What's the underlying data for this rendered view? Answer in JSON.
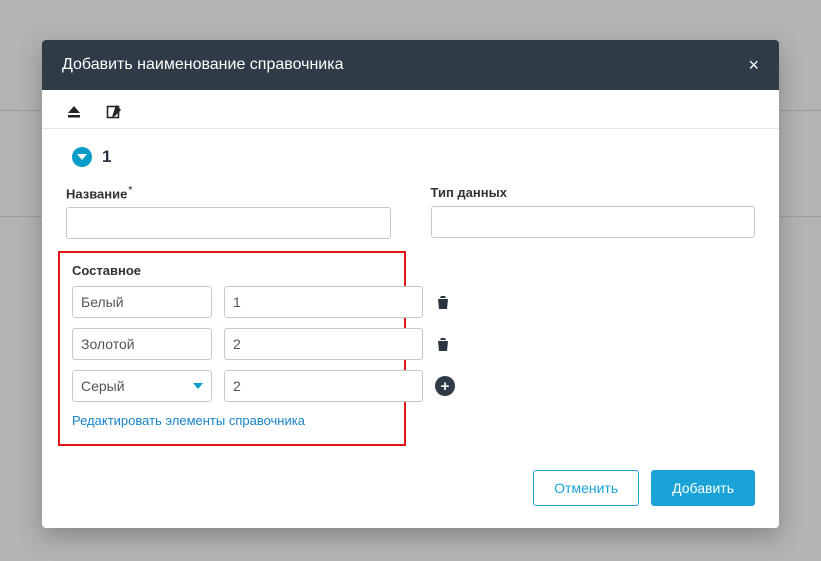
{
  "modal": {
    "title": "Добавить наименование справочника",
    "close_symbol": "×"
  },
  "section": {
    "number": "1"
  },
  "fields": {
    "name_label": "Название",
    "name_value": "",
    "type_label": "Тип данных",
    "type_value": ""
  },
  "composite": {
    "label": "Составное",
    "rows": [
      {
        "name": "Белый",
        "value": "1"
      },
      {
        "name": "Золотой",
        "value": "2"
      },
      {
        "name": "Серый",
        "value": "2"
      }
    ],
    "edit_link": "Редактировать элементы справочника"
  },
  "footer": {
    "cancel": "Отменить",
    "submit": "Добавить"
  }
}
